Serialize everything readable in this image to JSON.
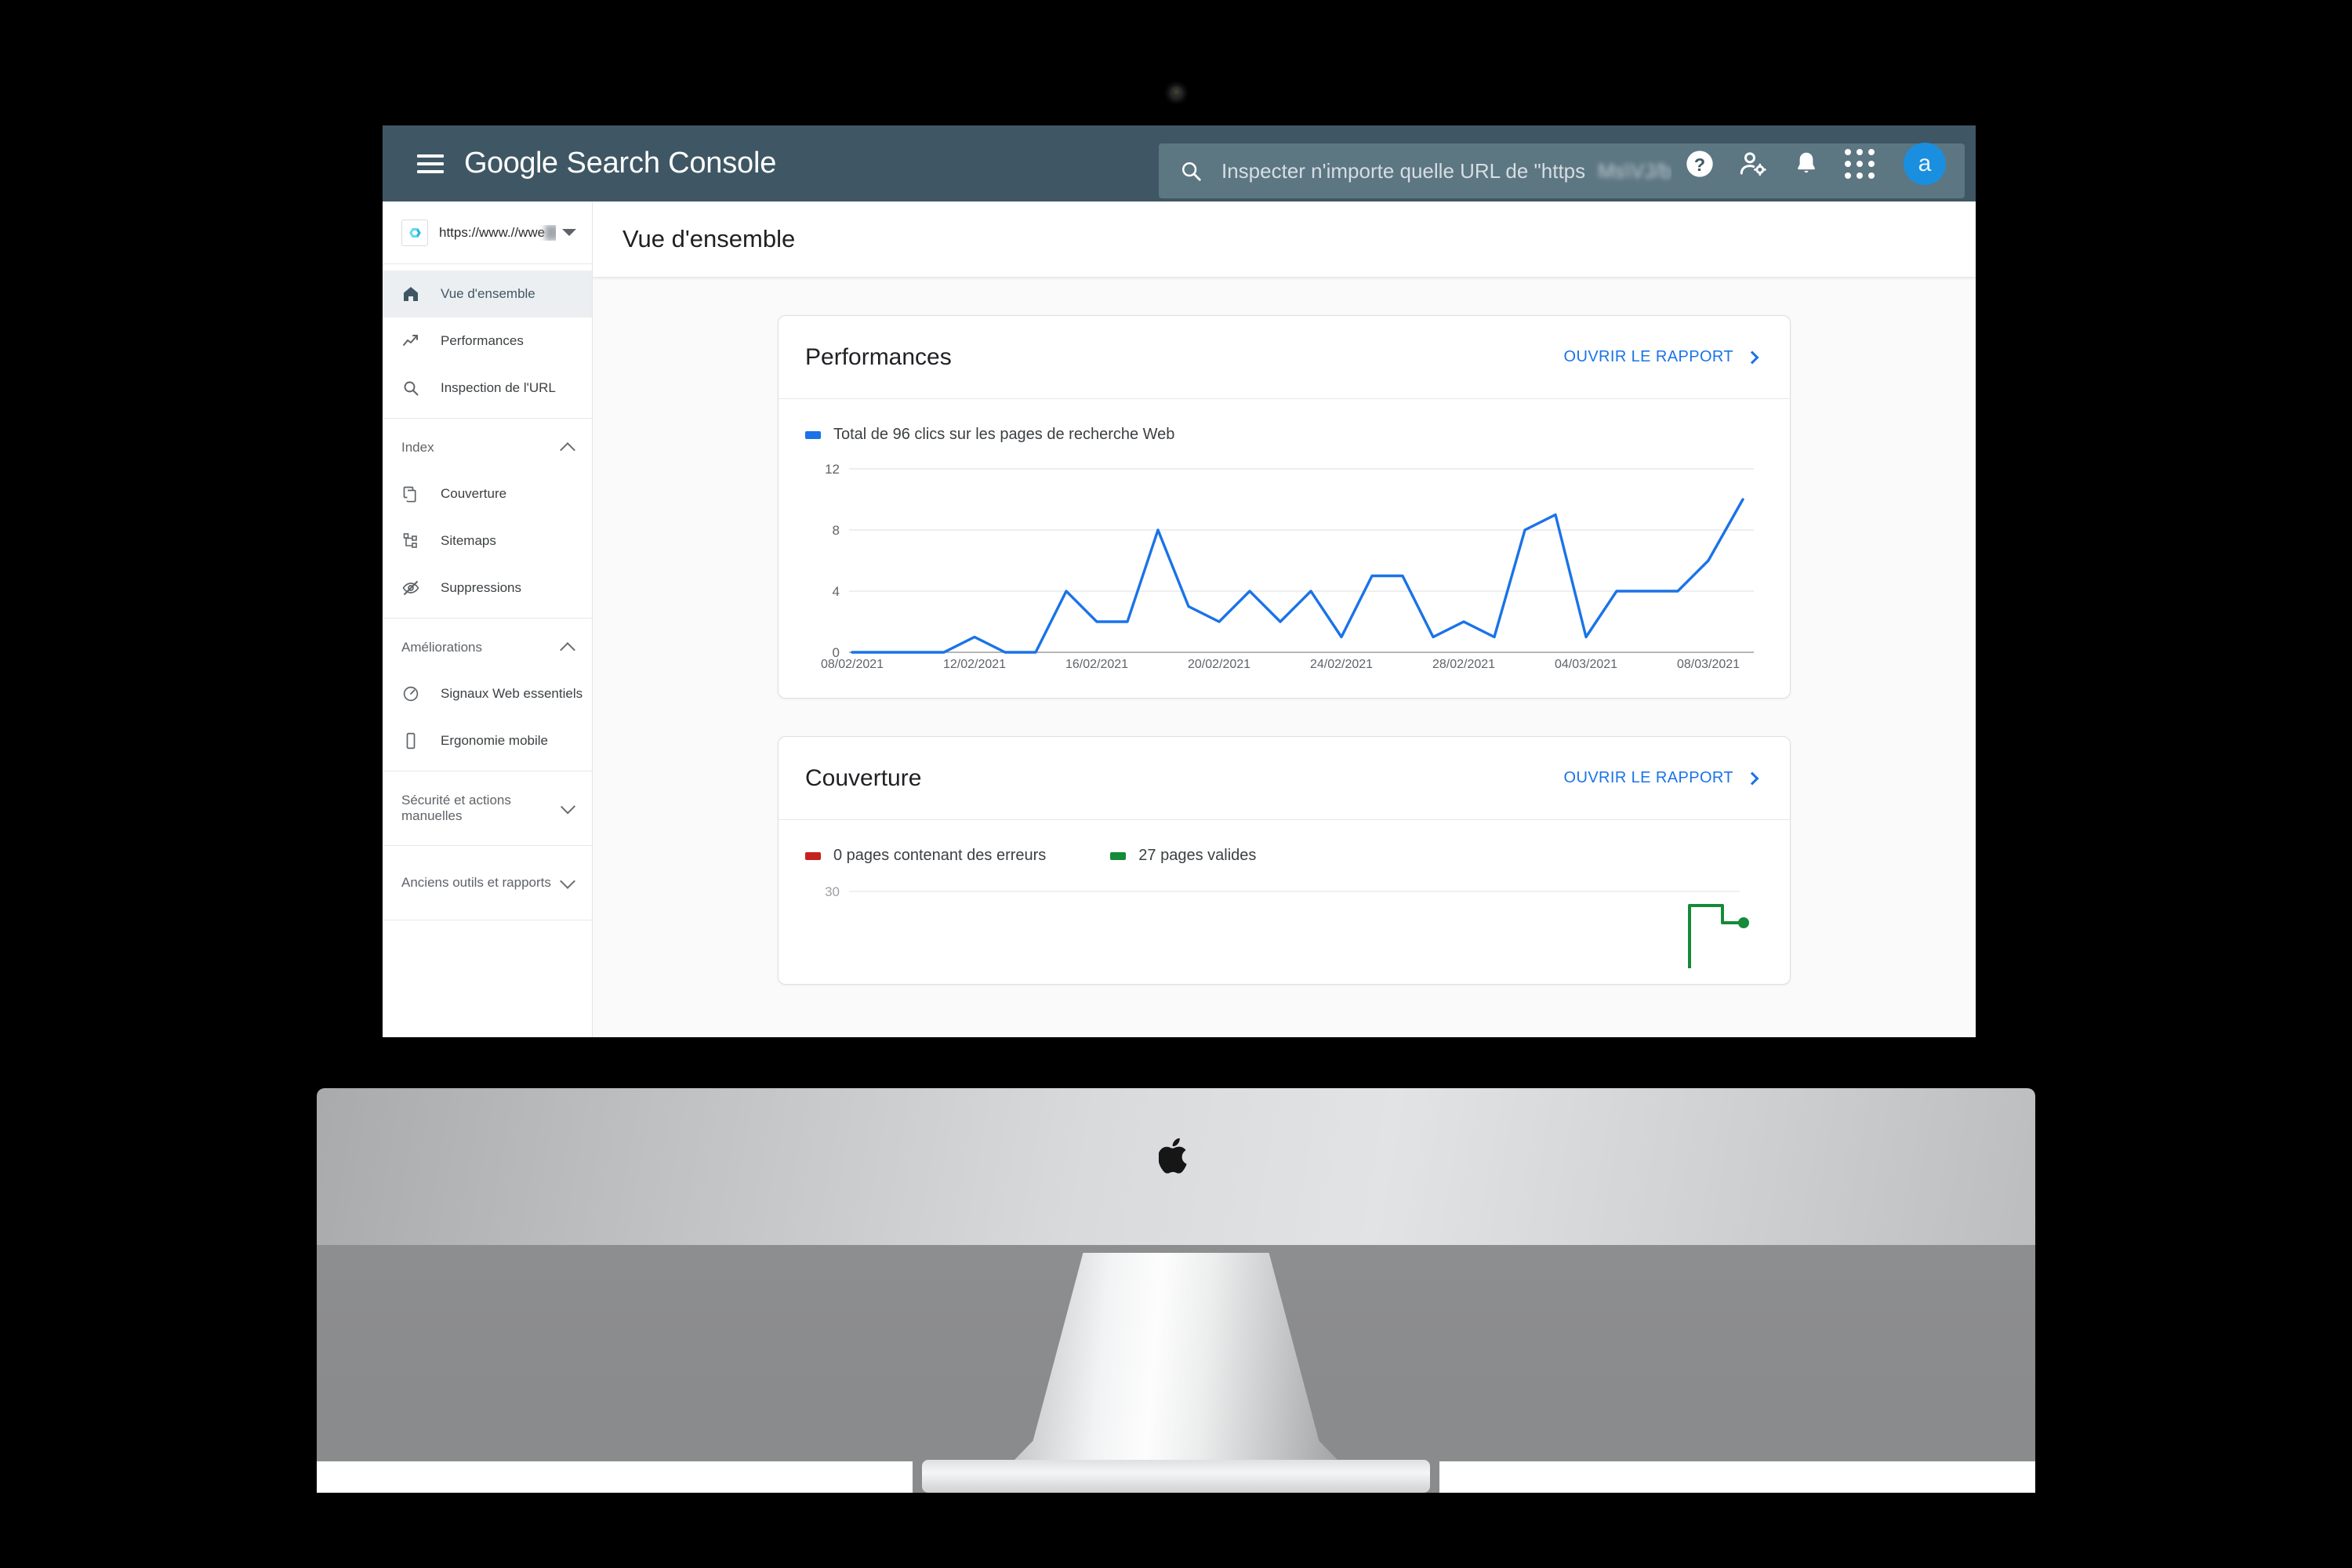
{
  "appbar": {
    "menu_icon": "hamburger-menu-icon",
    "brand_google": "Google",
    "brand_product": "Search Console",
    "search": {
      "icon": "search-icon",
      "placeholder": "Inspecter n'importe quelle URL de \"https",
      "redacted": "Ms\\VJ/b"
    },
    "icons": {
      "help": "help-circle-icon",
      "user_settings": "user-settings-icon",
      "notifications": "bell-icon",
      "apps": "apps-grid-icon"
    },
    "avatar_initial": "a"
  },
  "sidebar": {
    "property": {
      "favicon": "site-favicon-c-icon",
      "url": "https://www.//wwe",
      "redacted": "██████",
      "dropdown_icon": "caret-down-icon"
    },
    "top_items": [
      {
        "label": "Vue d'ensemble",
        "icon": "home-icon",
        "active": true
      },
      {
        "label": "Performances",
        "icon": "trending-up-icon",
        "active": false
      },
      {
        "label": "Inspection de l'URL",
        "icon": "search-icon",
        "active": false
      }
    ],
    "index_group": {
      "label": "Index",
      "expanded": true,
      "chevron": "chevron-up-icon",
      "items": [
        {
          "label": "Couverture",
          "icon": "pages-copy-icon"
        },
        {
          "label": "Sitemaps",
          "icon": "sitemap-icon"
        },
        {
          "label": "Suppressions",
          "icon": "eye-off-icon"
        }
      ]
    },
    "improvements_group": {
      "label": "Améliorations",
      "expanded": true,
      "chevron": "chevron-up-icon",
      "items": [
        {
          "label": "Signaux Web essentiels",
          "icon": "speedometer-icon"
        },
        {
          "label": "Ergonomie mobile",
          "icon": "mobile-phone-icon"
        }
      ]
    },
    "collapsed_groups": [
      {
        "label": "Sécurité et actions manuelles",
        "chevron": "chevron-down-icon"
      },
      {
        "label": "Anciens outils et rapports",
        "chevron": "chevron-down-icon"
      }
    ]
  },
  "main": {
    "page_title": "Vue d'ensemble",
    "cards": [
      {
        "title": "Performances",
        "action_label": "OUVRIR LE RAPPORT",
        "action_icon": "chevron-right-icon"
      },
      {
        "title": "Couverture",
        "action_label": "OUVRIR LE RAPPORT",
        "action_icon": "chevron-right-icon"
      }
    ]
  },
  "colors": {
    "appbar": "#3f5764",
    "link": "#1a73e8",
    "clicks_line": "#1a73e8",
    "valid_line": "#148a3a",
    "error_line": "#c5221f",
    "avatar": "#1a8fe0"
  },
  "chart_data": [
    {
      "type": "line",
      "title": "Performances",
      "legend": [
        {
          "label": "Total de 96 clics sur les pages de recherche Web",
          "color": "#1a73e8"
        }
      ],
      "legend_position": "top-left",
      "grid": true,
      "xlabel": "",
      "ylabel": "",
      "ylim": [
        0,
        12
      ],
      "yticks": [
        0,
        4,
        8,
        12
      ],
      "xticks": [
        "08/02/2021",
        "12/02/2021",
        "16/02/2021",
        "20/02/2021",
        "24/02/2021",
        "28/02/2021",
        "04/03/2021",
        "08/03/2021"
      ],
      "x": [
        "08/02/2021",
        "09/02/2021",
        "10/02/2021",
        "11/02/2021",
        "12/02/2021",
        "13/02/2021",
        "14/02/2021",
        "15/02/2021",
        "16/02/2021",
        "17/02/2021",
        "18/02/2021",
        "19/02/2021",
        "20/02/2021",
        "21/02/2021",
        "22/02/2021",
        "23/02/2021",
        "24/02/2021",
        "25/02/2021",
        "26/02/2021",
        "27/02/2021",
        "28/02/2021",
        "01/03/2021",
        "02/03/2021",
        "03/03/2021",
        "04/03/2021",
        "05/03/2021",
        "06/03/2021",
        "07/03/2021",
        "08/03/2021",
        "09/03/2021"
      ],
      "series": [
        {
          "name": "Clics",
          "color": "#1a73e8",
          "values": [
            0,
            0,
            0,
            0,
            1,
            0,
            0,
            4,
            2,
            2,
            8,
            3,
            2,
            4,
            2,
            4,
            1,
            5,
            5,
            1,
            2,
            1,
            8,
            9,
            1,
            4,
            4,
            4,
            6,
            10
          ]
        }
      ],
      "total_clicks": 96
    },
    {
      "type": "line",
      "title": "Couverture",
      "legend": [
        {
          "label": "0 pages contenant des erreurs",
          "color": "#c5221f",
          "value": 0
        },
        {
          "label": "27 pages valides",
          "color": "#148a3a",
          "value": 27
        }
      ],
      "legend_position": "top-left",
      "grid": true,
      "ylim": [
        0,
        30
      ],
      "yticks": [
        30
      ],
      "truncated": true,
      "series": [
        {
          "name": "Pages contenant des erreurs",
          "color": "#c5221f",
          "values": [
            0,
            0,
            0,
            0,
            0,
            0,
            0,
            0,
            0,
            0,
            0,
            0,
            0,
            0,
            0,
            0,
            0,
            0,
            0,
            0,
            0,
            0,
            0,
            0,
            0,
            0
          ]
        },
        {
          "name": "Pages valides",
          "color": "#148a3a",
          "values": [
            0,
            0,
            0,
            0,
            0,
            0,
            0,
            0,
            0,
            0,
            0,
            0,
            0,
            0,
            0,
            0,
            0,
            0,
            0,
            0,
            0,
            0,
            0,
            0,
            29,
            27,
            27
          ]
        }
      ]
    }
  ],
  "device": {
    "type": "imac-monitor",
    "logo": "apple-logo-icon",
    "webcam": "webcam-dot-icon"
  }
}
